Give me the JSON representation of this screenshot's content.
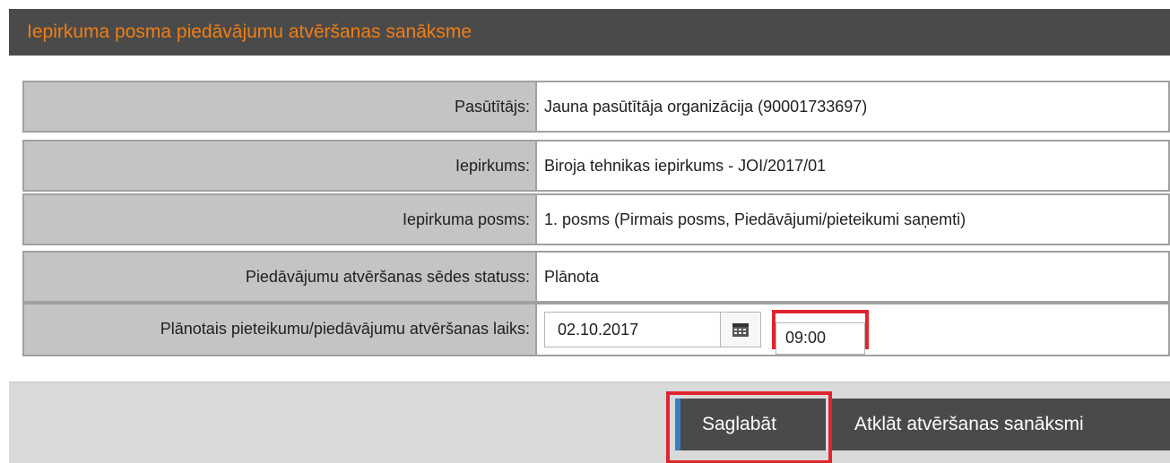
{
  "header": {
    "title": "Iepirkuma posma piedāvājumu atvēršanas sanāksme"
  },
  "fields": {
    "customer": {
      "label": "Pasūtītājs:",
      "value": "Jauna pasūtītāja organizācija (90001733697)"
    },
    "procurement": {
      "label": "Iepirkums:",
      "value": "Biroja tehnikas iepirkums - JOI/2017/01"
    },
    "stage": {
      "label": "Iepirkuma posms:",
      "value": "1. posms (Pirmais posms, Piedāvājumi/pieteikumi saņemti)"
    },
    "status": {
      "label": "Piedāvājumu atvēršanas sēdes statuss:",
      "value": "Plānota"
    },
    "planned_time": {
      "label": "Plānotais pieteikumu/piedāvājumu atvēršanas laiks:",
      "date": "02.10.2017",
      "time": "09:00"
    }
  },
  "footer": {
    "save_label": "Saglabāt",
    "open_meeting_label": "Atklāt atvēršanas sanāksmi"
  },
  "icons": {
    "calendar": "calendar-icon"
  },
  "colors": {
    "header_bg": "#4a4a4a",
    "header_text": "#f07e14",
    "label_bg": "#c4c4c4",
    "button_bg": "#4a4a4a",
    "save_accent": "#3a7fc1",
    "highlight": "#e0242e"
  }
}
